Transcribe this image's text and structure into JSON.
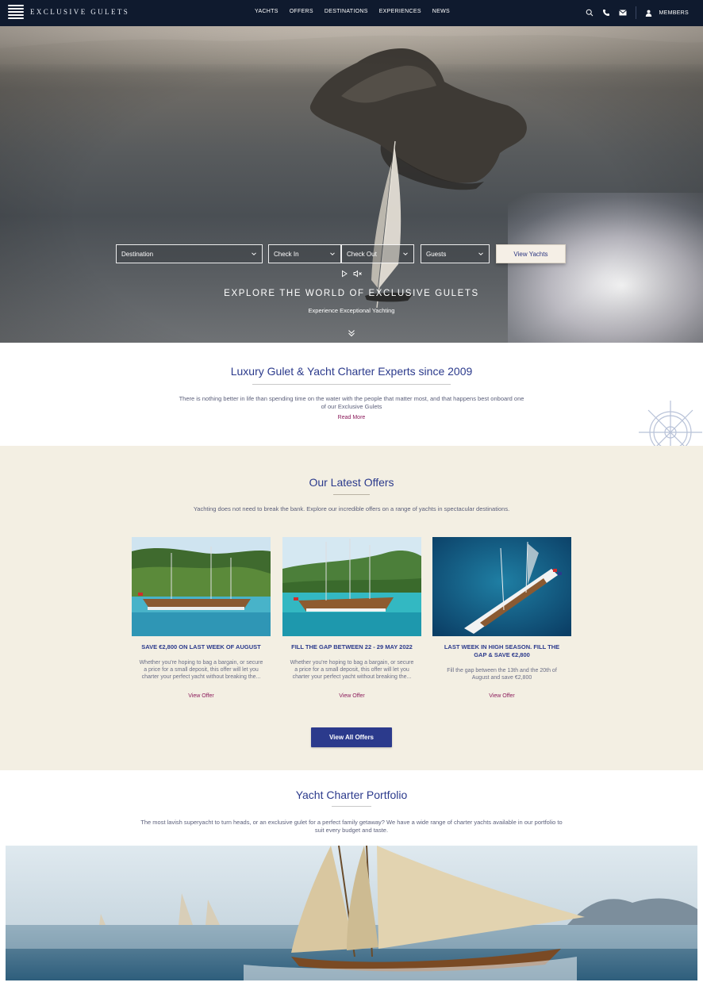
{
  "nav": {
    "logo_text": "EXCLUSIVE GULETS",
    "links": [
      "YACHTS",
      "OFFERS",
      "DESTINATIONS",
      "EXPERIENCES",
      "NEWS"
    ],
    "members_label": "MEMBERS",
    "icons": [
      "search-icon",
      "phone-icon",
      "mail-icon",
      "user-icon"
    ]
  },
  "hero": {
    "search": {
      "destination": "Destination",
      "check_in": "Check In",
      "check_out": "Check Out",
      "guests": "Guests",
      "button": "View Yachts"
    },
    "title": "EXPLORE THE WORLD OF EXCLUSIVE GULETS",
    "subtitle": "Experience Exceptional Yachting"
  },
  "intro": {
    "title": "Luxury Gulet & Yacht Charter Experts since 2009",
    "text": "There is nothing better in life than spending time on the water with the people that matter most, and that happens best onboard one of our Exclusive Gulets",
    "read_more": "Read More"
  },
  "offers": {
    "title": "Our Latest Offers",
    "lead": "Yachting does not need to break the bank. Explore our incredible offers on a range of yachts in spectacular destinations.",
    "cards": [
      {
        "title": "SAVE €2,800 ON LAST WEEK OF AUGUST",
        "text": "Whether you're hoping to bag a bargain, or secure a price for a small deposit, this offer will let you charter your perfect yacht without breaking the...",
        "link": "View Offer"
      },
      {
        "title": "FILL THE GAP BETWEEN 22 - 29 MAY 2022",
        "text": "Whether you're hoping to bag a bargain, or secure a price for a small deposit, this offer will let you charter your perfect yacht without breaking the...",
        "link": "View Offer"
      },
      {
        "title": "LAST WEEK IN HIGH SEASON. FILL THE GAP & SAVE €2,800",
        "text": "Fill the gap between the 13th and the 20th of August and save €2,800",
        "link": "View Offer"
      }
    ],
    "view_all": "View All Offers"
  },
  "portfolio": {
    "title": "Yacht Charter Portfolio",
    "text": "The most lavish superyacht to turn heads, or an exclusive gulet for a perfect family getaway? We have a wide range of charter yachts available in our portfolio to suit every budget and taste."
  },
  "colors": {
    "nav_bg": "#0f1a2e",
    "brand_blue": "#2b3a8c",
    "accent_magenta": "#8b1a5a",
    "offers_bg": "#f3efe3"
  }
}
